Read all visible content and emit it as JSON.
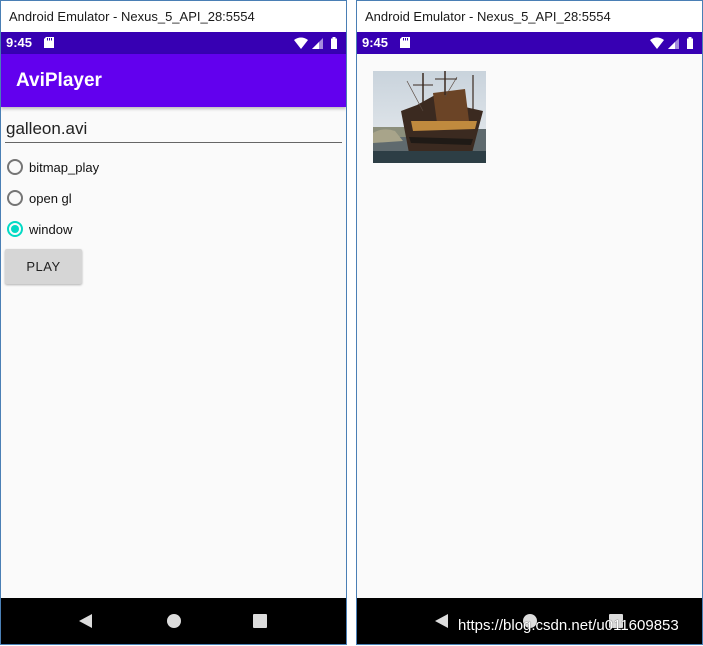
{
  "emulator": {
    "window_title": "Android Emulator - Nexus_5_API_28:5554",
    "status_time": "9:45"
  },
  "app": {
    "title": "AviPlayer",
    "filename_value": "galleon.avi",
    "radios": [
      {
        "label": "bitmap_play",
        "checked": false
      },
      {
        "label": "open gl",
        "checked": false
      },
      {
        "label": "window",
        "checked": true
      }
    ],
    "play_label": "PLAY"
  },
  "watermark": "https://blog.csdn.net/u011609853",
  "colors": {
    "status_bar": "#3700b3",
    "app_bar": "#6200ee",
    "accent": "#03dac5",
    "nav_bar": "#000000"
  },
  "icons": [
    "sd-card-icon",
    "wifi-icon",
    "signal-icon",
    "battery-icon",
    "back-icon",
    "home-icon",
    "recents-icon"
  ]
}
